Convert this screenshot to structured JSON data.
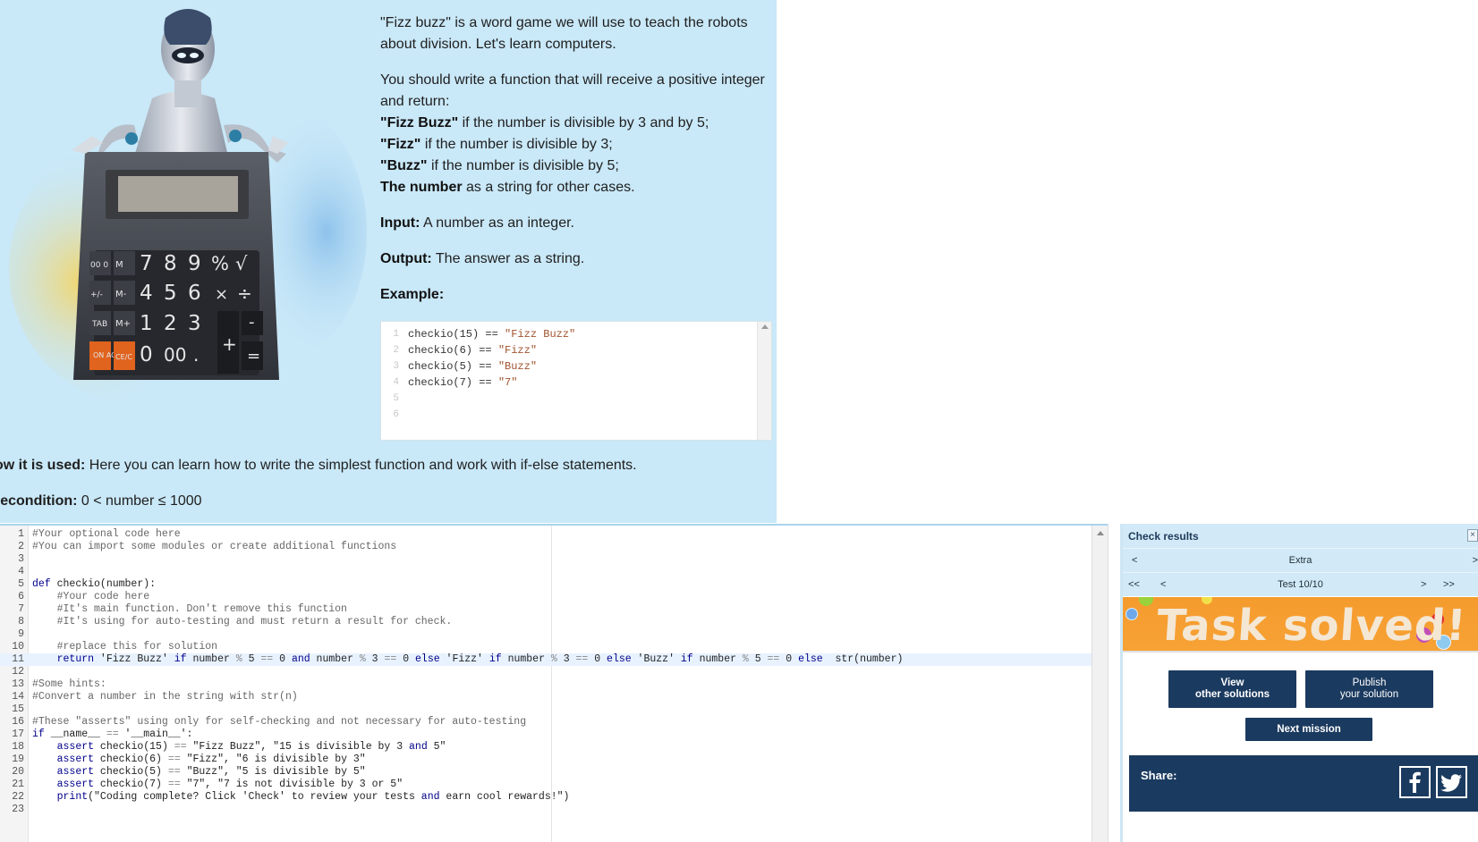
{
  "description": {
    "intro": "\"Fizz buzz\" is a word game we will use to teach the robots about division. Let's learn computers.",
    "task": "You should write a function that will receive a positive integer and return:",
    "rules": [
      {
        "bold": "\"Fizz Buzz\"",
        "rest": " if the number is divisible by 3 and by 5;"
      },
      {
        "bold": "\"Fizz\"",
        "rest": " if the number is divisible by 3;"
      },
      {
        "bold": "\"Buzz\"",
        "rest": " if the number is divisible by 5;"
      },
      {
        "bold": "The number",
        "rest": " as a string for other cases."
      }
    ],
    "input_label": "Input:",
    "input_text": " A number as an integer.",
    "output_label": "Output:",
    "output_text": " The answer as a string.",
    "example_label": "Example:",
    "how_label": "ow it is used:",
    "how_text": " Here you can learn how to write the simplest function and work with if-else statements.",
    "pre_label": "recondition:",
    "pre_text": " 0 < number ≤ 1000"
  },
  "calculator": {
    "keys_row1": [
      "00 0",
      "M R C",
      "7",
      "8",
      "9",
      "%",
      "√"
    ],
    "keys_row2": [
      "+/-",
      "M-",
      "4",
      "5",
      "6",
      "×",
      "÷"
    ],
    "keys_row3": [
      "TAB",
      "M+",
      "1",
      "2",
      "3",
      "+",
      "-"
    ],
    "keys_row4": [
      "ON AC",
      "CE/C",
      "0",
      "00",
      ".",
      "="
    ]
  },
  "example_code": [
    {
      "n": "1",
      "pre": "checkio(15) == ",
      "str": "\"Fizz Buzz\""
    },
    {
      "n": "2",
      "pre": "checkio(6) == ",
      "str": "\"Fizz\""
    },
    {
      "n": "3",
      "pre": "checkio(5) == ",
      "str": "\"Buzz\""
    },
    {
      "n": "4",
      "pre": "checkio(7) == ",
      "str": "\"7\""
    },
    {
      "n": "5",
      "pre": "",
      "str": ""
    },
    {
      "n": "6",
      "pre": "",
      "str": ""
    }
  ],
  "editor": {
    "lines": [
      {
        "n": "1",
        "code": "#Your optional code here"
      },
      {
        "n": "2",
        "code": "#You can import some modules or create additional functions"
      },
      {
        "n": "3",
        "code": ""
      },
      {
        "n": "4",
        "code": ""
      },
      {
        "n": "5",
        "code": "def checkio(number):"
      },
      {
        "n": "6",
        "code": "    #Your code here"
      },
      {
        "n": "7",
        "code": "    #It's main function. Don't remove this function"
      },
      {
        "n": "8",
        "code": "    #It's using for auto-testing and must return a result for check."
      },
      {
        "n": "9",
        "code": ""
      },
      {
        "n": "10",
        "code": "    #replace this for solution"
      },
      {
        "n": "11",
        "code": "    return 'Fizz Buzz' if number % 5 == 0 and number % 3 == 0 else 'Fizz' if number % 3 == 0 else 'Buzz' if number % 5 == 0 else  str(number)"
      },
      {
        "n": "12",
        "code": ""
      },
      {
        "n": "13",
        "code": "#Some hints:"
      },
      {
        "n": "14",
        "code": "#Convert a number in the string with str(n)"
      },
      {
        "n": "15",
        "code": ""
      },
      {
        "n": "16",
        "code": "#These \"asserts\" using only for self-checking and not necessary for auto-testing"
      },
      {
        "n": "17",
        "code": "if __name__ == '__main__':"
      },
      {
        "n": "18",
        "code": "    assert checkio(15) == \"Fizz Buzz\", \"15 is divisible by 3 and 5\""
      },
      {
        "n": "19",
        "code": "    assert checkio(6) == \"Fizz\", \"6 is divisible by 3\""
      },
      {
        "n": "20",
        "code": "    assert checkio(5) == \"Buzz\", \"5 is divisible by 5\""
      },
      {
        "n": "21",
        "code": "    assert checkio(7) == \"7\", \"7 is not divisible by 3 or 5\""
      },
      {
        "n": "22",
        "code": "    print(\"Coding complete? Click 'Check' to review your tests and earn cool rewards!\")"
      },
      {
        "n": "23",
        "code": ""
      }
    ],
    "active_line": 11
  },
  "results": {
    "title": "Check results",
    "close": "×",
    "category_prev": "<",
    "category": "Extra",
    "category_next": ">",
    "first": "<<",
    "prev": "<",
    "test": "Test 10/10",
    "next": ">",
    "last": ">>",
    "banner": "Task solved!",
    "view_line1": "View",
    "view_line2": "other solutions",
    "publish_line1": "Publish",
    "publish_line2": "your solution",
    "next_mission": "Next mission",
    "share": "Share:"
  },
  "colors": {
    "panel_bg": "#c9e8f8",
    "navy": "#1b3a5f",
    "banner_orange": "#f59b2e"
  },
  "icons": [
    "facebook-icon",
    "twitter-icon",
    "robot-illustration",
    "calculator-illustration"
  ]
}
